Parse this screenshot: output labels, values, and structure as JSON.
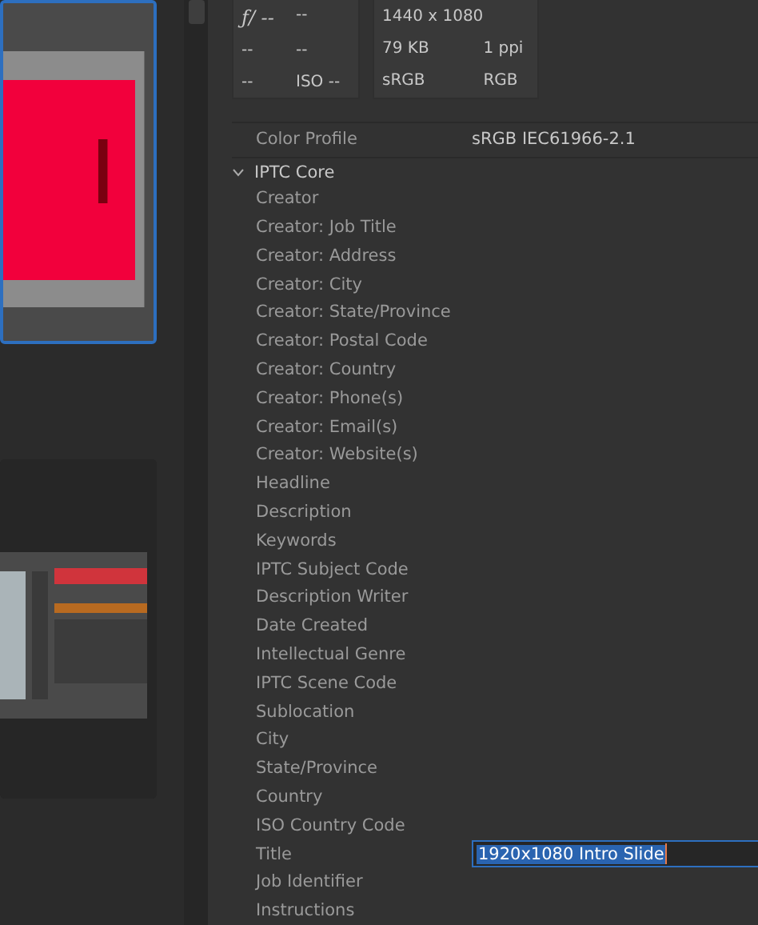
{
  "thumbnails": [
    {
      "kind": "picture",
      "selected": true
    },
    {
      "kind": "picture",
      "selected": false
    }
  ],
  "camera": {
    "rows": [
      [
        "ƒ/ --",
        "--"
      ],
      [
        "--",
        "--"
      ],
      [
        "--",
        "ISO --"
      ]
    ]
  },
  "file_info": {
    "rows": [
      [
        "1440 x 1080",
        ""
      ],
      [
        "79 KB",
        "1 ppi"
      ],
      [
        "sRGB",
        "RGB"
      ]
    ]
  },
  "rows_before": [
    {
      "label": "Color Profile",
      "value": "sRGB IEC61966-2.1"
    }
  ],
  "section": {
    "title": "IPTC Core",
    "expanded": true,
    "fields": [
      {
        "label": "Creator"
      },
      {
        "label": "Creator: Job Title"
      },
      {
        "label": "Creator: Address"
      },
      {
        "label": "Creator: City"
      },
      {
        "label": "Creator: State/Province"
      },
      {
        "label": "Creator: Postal Code"
      },
      {
        "label": "Creator: Country"
      },
      {
        "label": "Creator: Phone(s)"
      },
      {
        "label": "Creator: Email(s)"
      },
      {
        "label": "Creator: Website(s)"
      },
      {
        "label": "Headline"
      },
      {
        "label": "Description"
      },
      {
        "label": "Keywords"
      },
      {
        "label": "IPTC Subject Code"
      },
      {
        "label": "Description Writer"
      },
      {
        "label": "Date Created"
      },
      {
        "label": "Intellectual Genre"
      },
      {
        "label": "IPTC Scene Code"
      },
      {
        "label": "Sublocation"
      },
      {
        "label": "City"
      },
      {
        "label": "State/Province"
      },
      {
        "label": "Country"
      },
      {
        "label": "ISO Country Code"
      },
      {
        "label": "Title",
        "value": "1920x1080 Intro Slide",
        "editing": true
      },
      {
        "label": "Job Identifier"
      },
      {
        "label": "Instructions"
      }
    ]
  }
}
